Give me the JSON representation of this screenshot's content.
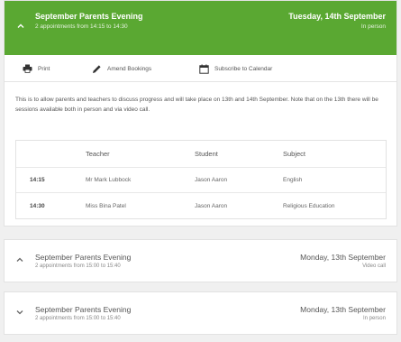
{
  "expanded_event": {
    "title": "September Parents Evening",
    "subtitle": "2 appointments from 14:15 to 14:30",
    "date": "Tuesday, 14th September",
    "mode": "In person",
    "accent_color": "#5aa832",
    "toolbar": {
      "print_label": "Print",
      "amend_label": "Amend Bookings",
      "subscribe_label": "Subscribe to Calendar"
    },
    "description": "This is to allow parents and teachers to discuss progress and will take place on 13th and 14th September. Note that on the 13th there will be sessions available both in person and via video call.",
    "table": {
      "headers": [
        "",
        "Teacher",
        "Student",
        "Subject"
      ],
      "rows": [
        {
          "time": "14:15",
          "teacher": "Mr Mark Lubbock",
          "student": "Jason Aaron",
          "subject": "English"
        },
        {
          "time": "14:30",
          "teacher": "Miss Bina Patel",
          "student": "Jason Aaron",
          "subject": "Religious Education"
        }
      ]
    }
  },
  "collapsed_events": [
    {
      "title": "September Parents Evening",
      "subtitle": "2 appointments from 15:00 to 15:40",
      "date": "Monday, 13th September",
      "mode": "Video call"
    },
    {
      "title": "September Parents Evening",
      "subtitle": "2 appointments from 15:00 to 15:40",
      "date": "Monday, 13th September",
      "mode": "In person"
    }
  ],
  "icons": {
    "expanded_chevron": "chevron-up-icon",
    "print": "printer-icon",
    "amend": "pencil-icon",
    "subscribe": "calendar-icon",
    "collapsed_chevron_1": "chevron-up-icon",
    "collapsed_chevron_2": "chevron-down-icon"
  }
}
